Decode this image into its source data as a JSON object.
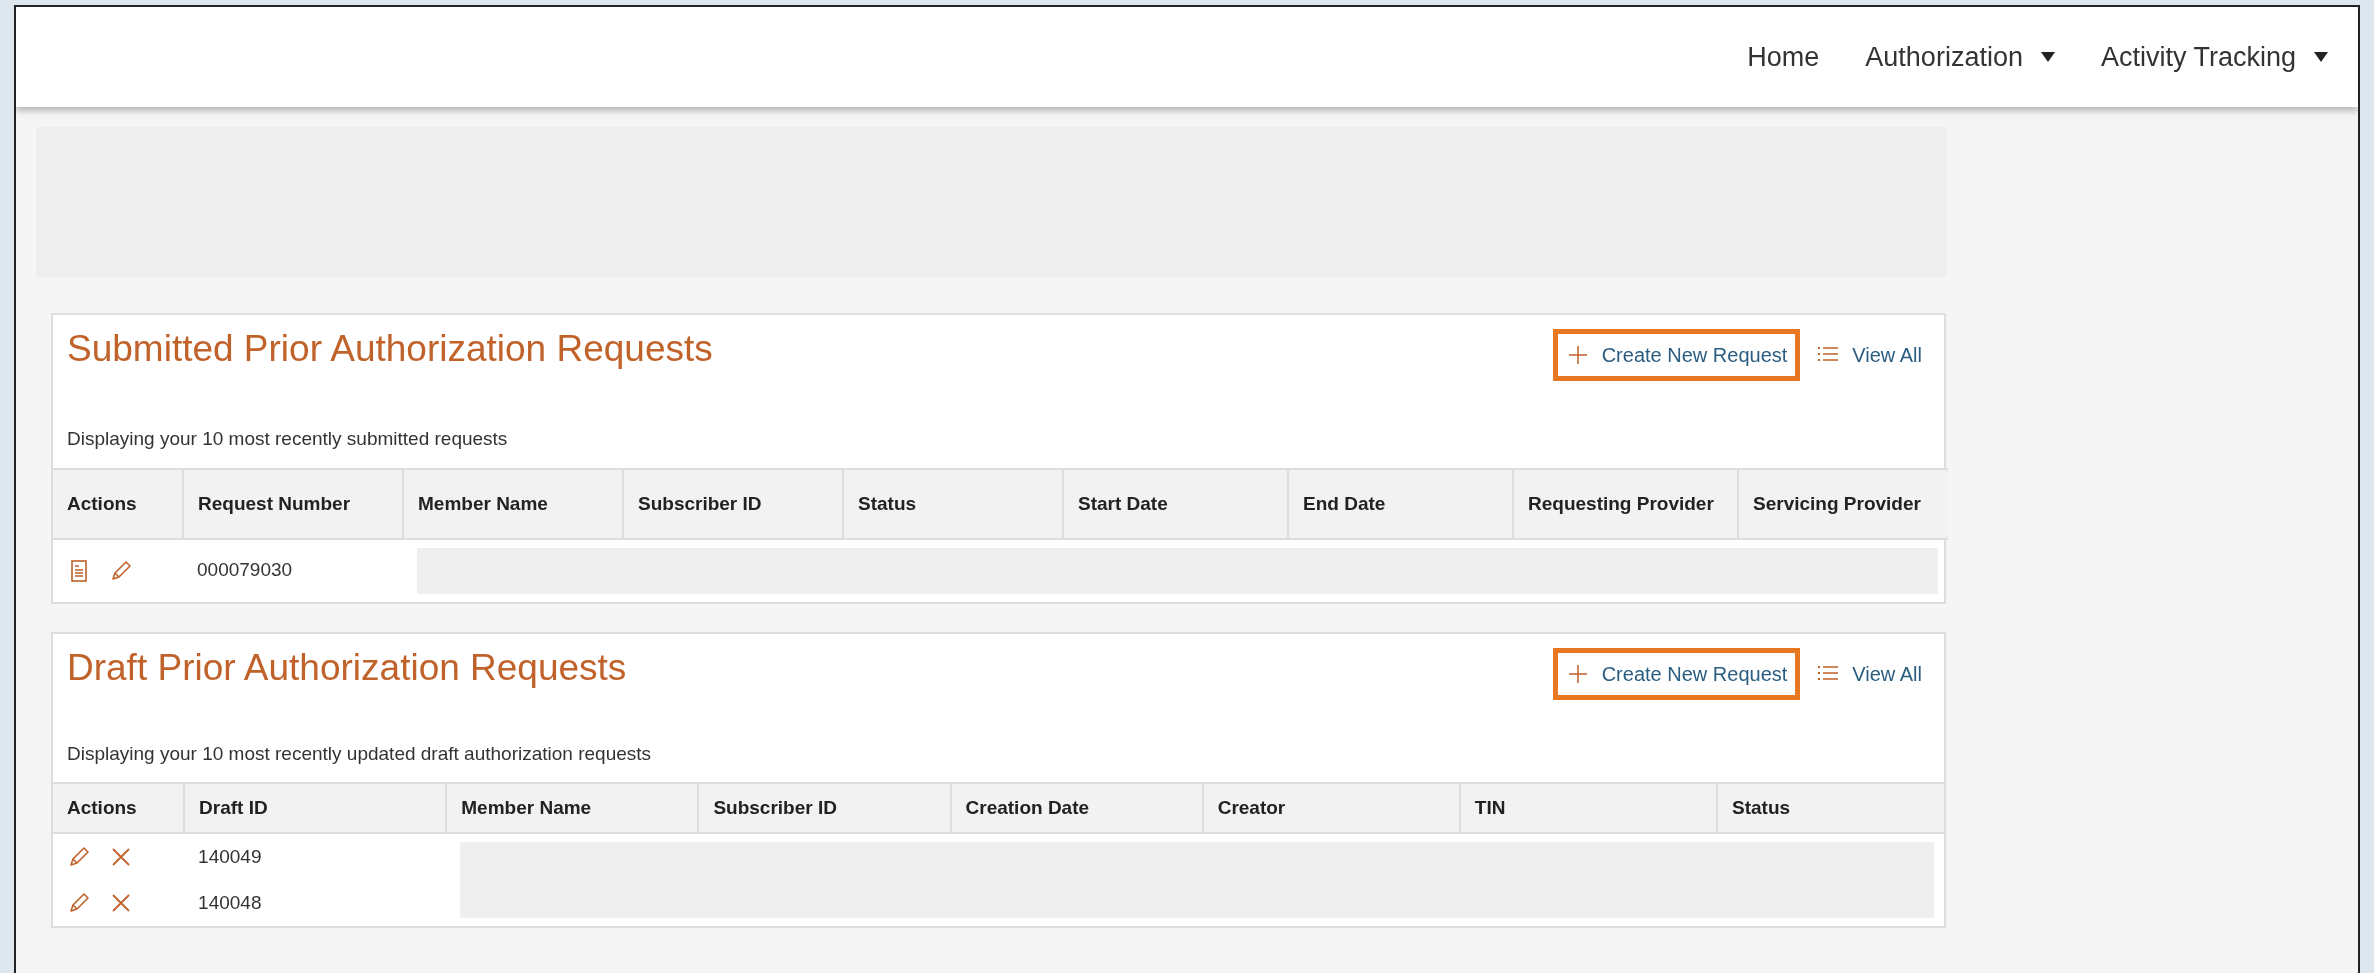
{
  "navbar": {
    "items": [
      {
        "label": "Home",
        "dropdown": false
      },
      {
        "label": "Authorization",
        "dropdown": true
      },
      {
        "label": "Activity Tracking",
        "dropdown": true
      }
    ]
  },
  "cards": [
    {
      "title": "Submitted Prior Authorization Requests",
      "create_label": "Create New Request",
      "create_highlighted": true,
      "view_all_label": "View All",
      "subtitle": "Displaying your 10 most recently submitted requests",
      "columns": [
        "Actions",
        "Request Number",
        "Member Name",
        "Subscriber ID",
        "Status",
        "Start Date",
        "End Date",
        "Requesting Provider",
        "Servicing Provider"
      ],
      "redacted": true,
      "rows": [
        {
          "actions": [
            {
              "kind": "view"
            },
            {
              "kind": "edit"
            }
          ],
          "id": "000079030"
        }
      ]
    },
    {
      "title": "Draft Prior Authorization Requests",
      "create_label": "Create New Request",
      "create_highlighted": true,
      "view_all_label": "View All",
      "subtitle": "Displaying your 10 most recently updated draft authorization requests",
      "columns": [
        "Actions",
        "Draft ID",
        "Member Name",
        "Subscriber ID",
        "Creation Date",
        "Creator",
        "TIN",
        "Status"
      ],
      "redacted": true,
      "rows": [
        {
          "actions": [
            {
              "kind": "edit"
            },
            {
              "kind": "delete"
            }
          ],
          "id": "140049"
        },
        {
          "actions": [
            {
              "kind": "edit"
            },
            {
              "kind": "delete"
            }
          ],
          "id": "140048"
        }
      ]
    }
  ]
}
